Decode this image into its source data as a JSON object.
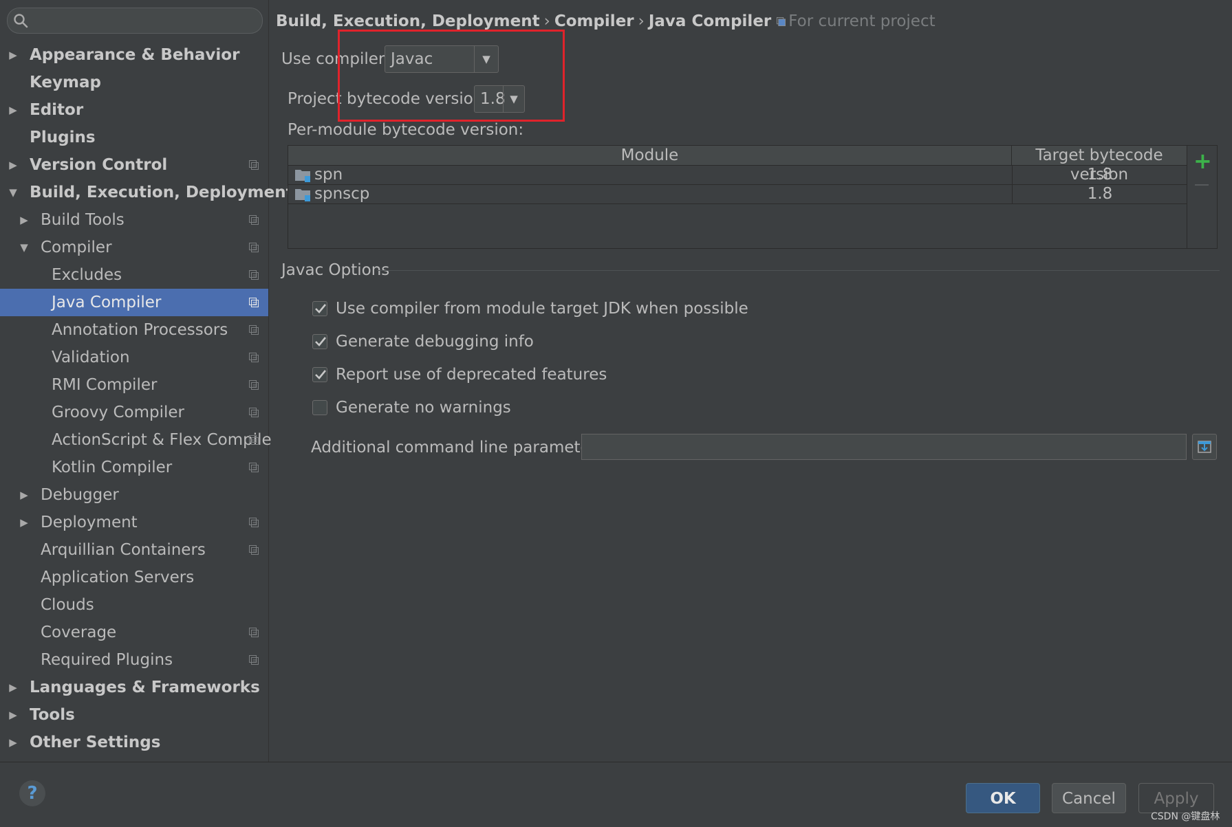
{
  "search": {
    "placeholder": ""
  },
  "sidebar": {
    "items": [
      {
        "label": "Appearance & Behavior",
        "arrow": "▶",
        "bold": true,
        "indent": 0,
        "proj": false
      },
      {
        "label": "Keymap",
        "arrow": "",
        "bold": true,
        "indent": 0,
        "proj": false
      },
      {
        "label": "Editor",
        "arrow": "▶",
        "bold": true,
        "indent": 0,
        "proj": false
      },
      {
        "label": "Plugins",
        "arrow": "",
        "bold": true,
        "indent": 0,
        "proj": false
      },
      {
        "label": "Version Control",
        "arrow": "▶",
        "bold": true,
        "indent": 0,
        "proj": true
      },
      {
        "label": "Build, Execution, Deployment",
        "arrow": "▼",
        "bold": true,
        "indent": 0,
        "proj": false
      },
      {
        "label": "Build Tools",
        "arrow": "▶",
        "bold": false,
        "indent": 1,
        "proj": true
      },
      {
        "label": "Compiler",
        "arrow": "▼",
        "bold": false,
        "indent": 1,
        "proj": true
      },
      {
        "label": "Excludes",
        "arrow": "",
        "bold": false,
        "indent": 2,
        "proj": true
      },
      {
        "label": "Java Compiler",
        "arrow": "",
        "bold": false,
        "indent": 2,
        "proj": true,
        "selected": true
      },
      {
        "label": "Annotation Processors",
        "arrow": "",
        "bold": false,
        "indent": 2,
        "proj": true
      },
      {
        "label": "Validation",
        "arrow": "",
        "bold": false,
        "indent": 2,
        "proj": true
      },
      {
        "label": "RMI Compiler",
        "arrow": "",
        "bold": false,
        "indent": 2,
        "proj": true
      },
      {
        "label": "Groovy Compiler",
        "arrow": "",
        "bold": false,
        "indent": 2,
        "proj": true
      },
      {
        "label": "ActionScript & Flex Compile",
        "arrow": "",
        "bold": false,
        "indent": 2,
        "proj": true
      },
      {
        "label": "Kotlin Compiler",
        "arrow": "",
        "bold": false,
        "indent": 2,
        "proj": true
      },
      {
        "label": "Debugger",
        "arrow": "▶",
        "bold": false,
        "indent": 1,
        "proj": false
      },
      {
        "label": "Deployment",
        "arrow": "▶",
        "bold": false,
        "indent": 1,
        "proj": true
      },
      {
        "label": "Arquillian Containers",
        "arrow": "",
        "bold": false,
        "indent": 1,
        "proj": true
      },
      {
        "label": "Application Servers",
        "arrow": "",
        "bold": false,
        "indent": 1,
        "proj": false
      },
      {
        "label": "Clouds",
        "arrow": "",
        "bold": false,
        "indent": 1,
        "proj": false
      },
      {
        "label": "Coverage",
        "arrow": "",
        "bold": false,
        "indent": 1,
        "proj": true
      },
      {
        "label": "Required Plugins",
        "arrow": "",
        "bold": false,
        "indent": 1,
        "proj": true
      },
      {
        "label": "Languages & Frameworks",
        "arrow": "▶",
        "bold": true,
        "indent": 0,
        "proj": false
      },
      {
        "label": "Tools",
        "arrow": "▶",
        "bold": true,
        "indent": 0,
        "proj": false
      },
      {
        "label": "Other Settings",
        "arrow": "▶",
        "bold": true,
        "indent": 0,
        "proj": false
      }
    ]
  },
  "breadcrumb": {
    "parts": [
      "Build, Execution, Deployment",
      "Compiler",
      "Java Compiler"
    ],
    "separator": "›",
    "scope": "For current project"
  },
  "compiler": {
    "use_compiler_label": "Use compiler:",
    "use_compiler_value": "Javac",
    "bytecode_label": "Project bytecode version:",
    "bytecode_value": "1.8",
    "per_module_label": "Per-module bytecode version:"
  },
  "module_table": {
    "headers": [
      "Module",
      "Target bytecode version"
    ],
    "rows": [
      {
        "module": "spn",
        "version": "1.8"
      },
      {
        "module": "spnscp",
        "version": "1.8"
      }
    ],
    "add": "+"
  },
  "javac_options": {
    "title": "Javac Options",
    "checks": [
      {
        "label": "Use compiler from module target JDK when possible",
        "checked": true
      },
      {
        "label": "Generate debugging info",
        "checked": true
      },
      {
        "label": "Report use of deprecated features",
        "checked": true
      },
      {
        "label": "Generate no warnings",
        "checked": false
      }
    ],
    "cmd_label": "Additional command line parameters:",
    "cmd_value": ""
  },
  "footer": {
    "help": "?",
    "ok": "OK",
    "cancel": "Cancel",
    "apply": "Apply",
    "watermark": "CSDN @键盘林"
  },
  "colors": {
    "background": "#3c3f41",
    "selection": "#4b6eaf",
    "highlight_box": "#e0232b",
    "add_icon": "#3cb24a",
    "ok_button": "#365880"
  }
}
